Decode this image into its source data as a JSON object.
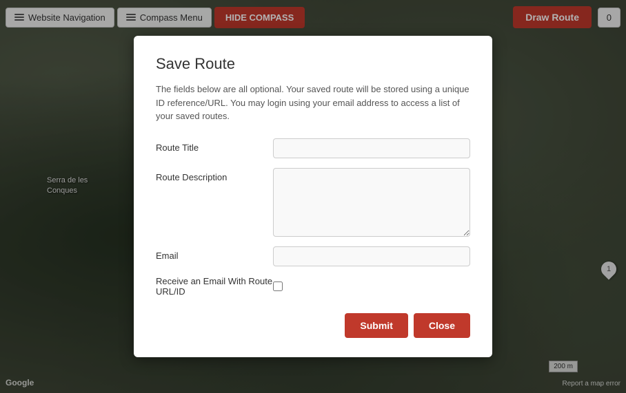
{
  "navbar": {
    "website_navigation_label": "Website Navigation",
    "compass_menu_label": "Compass Menu",
    "hide_compass_label": "HIDE COMPASS",
    "draw_route_label": "Draw Route",
    "cart_count": "0"
  },
  "map": {
    "google_watermark": "Google",
    "location_label_line1": "Serra de les",
    "location_label_line2": "Conques",
    "scale_text": "200 m",
    "report_error_text": "Report a map error",
    "pin_number": "1"
  },
  "modal": {
    "title": "Save Route",
    "description": "The fields below are all optional. Your saved route will be stored using a unique ID reference/URL. You may login using your email address to access a list of your saved routes.",
    "route_title_label": "Route Title",
    "route_title_placeholder": "",
    "route_description_label": "Route Description",
    "route_description_placeholder": "",
    "email_label": "Email",
    "email_placeholder": "",
    "receive_email_label": "Receive an Email With Route URL/ID",
    "submit_label": "Submit",
    "close_label": "Close"
  }
}
